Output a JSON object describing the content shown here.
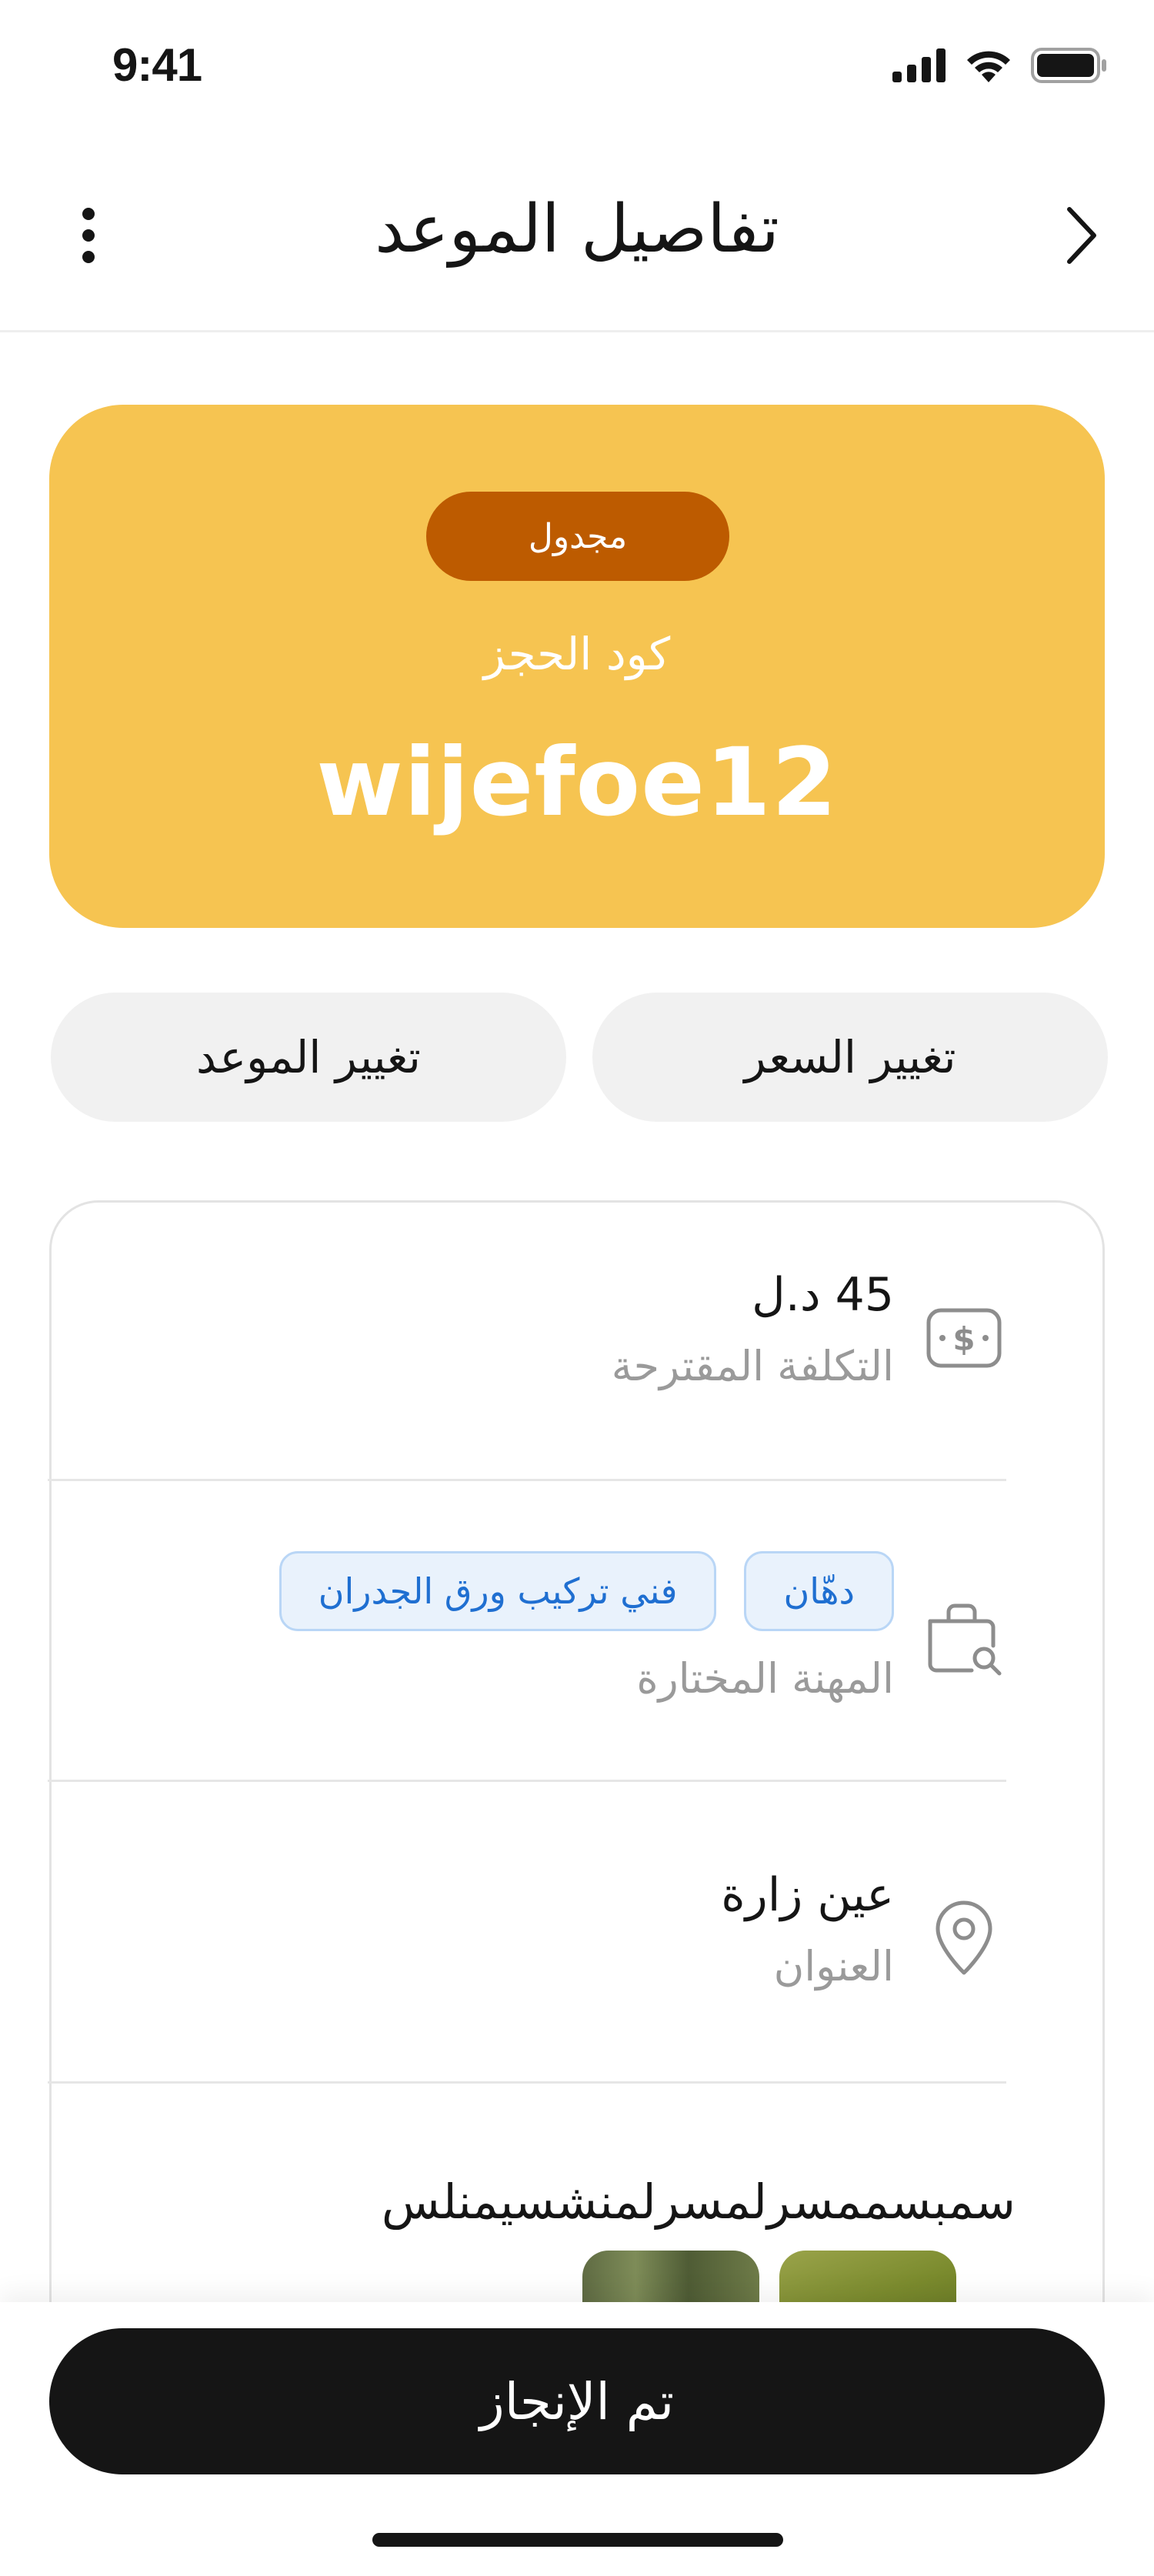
{
  "status_bar": {
    "time": "9:41"
  },
  "header": {
    "title": "تفاصيل الموعد"
  },
  "booking": {
    "status": "مجدول",
    "code_label": "كود الحجز",
    "code": "wijefoe12"
  },
  "actions": {
    "change_price": "تغيير السعر",
    "change_time": "تغيير الموعد"
  },
  "details": {
    "cost": {
      "value": "45 د.ل",
      "label": "التكلفة المقترحة",
      "icon": "dollar-icon"
    },
    "profession": {
      "tags": [
        "دهّان",
        "فني تركيب ورق الجدران"
      ],
      "label": "المهنة المختارة",
      "icon": "briefcase-search-icon"
    },
    "address": {
      "value": "عين زارة",
      "label": "العنوان",
      "icon": "location-pin-icon"
    },
    "notes": {
      "text": "سمبسممسرلمسرلمنشسيمنلس"
    }
  },
  "footer": {
    "done_button": "تم الإنجاز"
  },
  "colors": {
    "card": "#f6c451",
    "badge": "#bd5b00",
    "primary": "#151515",
    "tag_bg": "#e9f2fc",
    "tag_text": "#1f6fd1"
  }
}
